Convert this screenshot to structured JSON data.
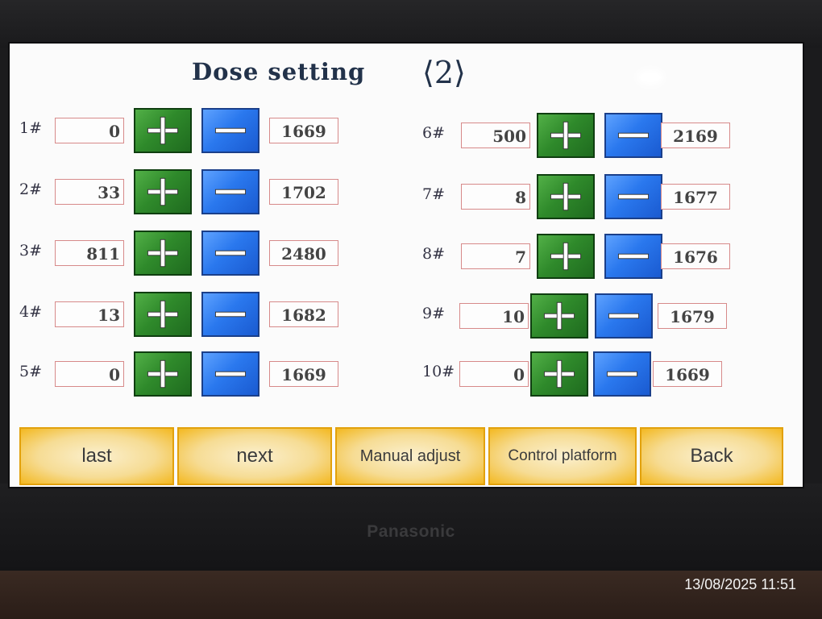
{
  "screen": {
    "title": "Dose setting",
    "page_indicator": "⟨2⟩"
  },
  "rows": [
    {
      "label": "1#",
      "value": "0",
      "total": "1669"
    },
    {
      "label": "2#",
      "value": "33",
      "total": "1702"
    },
    {
      "label": "3#",
      "value": "811",
      "total": "2480"
    },
    {
      "label": "4#",
      "value": "13",
      "total": "1682"
    },
    {
      "label": "5#",
      "value": "0",
      "total": "1669"
    },
    {
      "label": "6#",
      "value": "500",
      "total": "2169"
    },
    {
      "label": "7#",
      "value": "8",
      "total": "1677"
    },
    {
      "label": "8#",
      "value": "7",
      "total": "1676"
    },
    {
      "label": "9#",
      "value": "10",
      "total": "1679"
    },
    {
      "label": "10#",
      "value": "0",
      "total": "1669"
    }
  ],
  "icons": {
    "increment": "plus-icon",
    "decrement": "minus-icon"
  },
  "buttons": {
    "last": "last",
    "next": "next",
    "manual_adjust": "Manual adjust",
    "control_platform": "Control platform",
    "back": "Back"
  },
  "device": {
    "brand": "Panasonic"
  },
  "photo": {
    "timestamp": "13/08/2025 11:51"
  },
  "colors": {
    "plus_green": "#2f8a2b",
    "minus_blue": "#2a78ee",
    "nav_yellow": "#f3b820",
    "field_border": "#d78a8a"
  }
}
